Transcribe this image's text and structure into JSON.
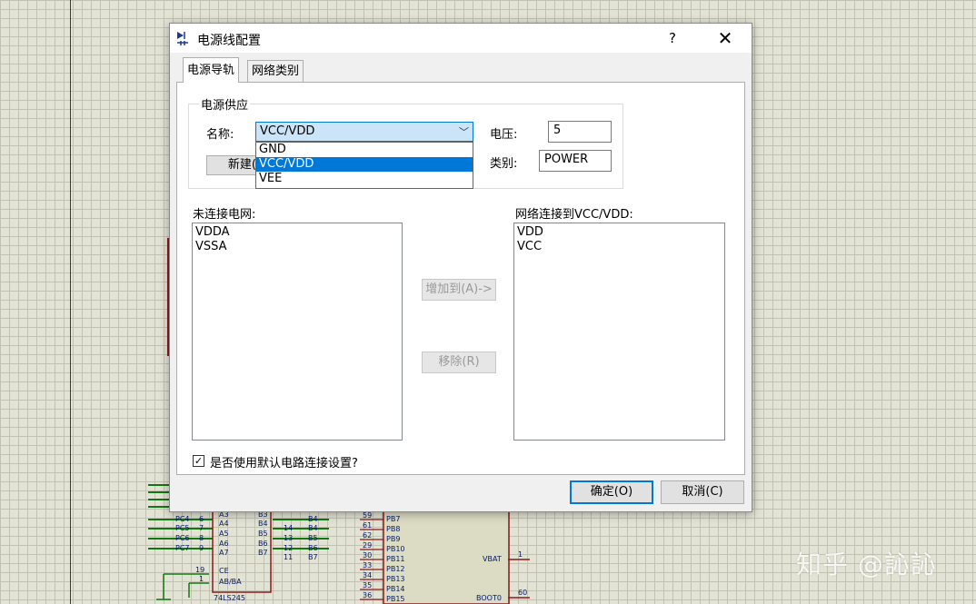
{
  "dialog": {
    "title": "电源线配置",
    "help_glyph": "?",
    "close_glyph": "✕",
    "tabs": [
      {
        "label": "电源导轨"
      },
      {
        "label": "网络类别"
      }
    ],
    "supply_group": {
      "label": "电源供应",
      "name_label": "名称:",
      "name_value": "VCC/VDD",
      "options": [
        "GND",
        "VCC/VDD",
        "VEE"
      ],
      "selected_option": "VCC/VDD",
      "new_button": "新建(",
      "voltage_label": "电压:",
      "voltage_value": "5",
      "class_label": "类别:",
      "class_value": "POWER"
    },
    "unconnected": {
      "label": "未连接电网:",
      "items": [
        "VDDA",
        "VSSA"
      ]
    },
    "connected": {
      "label": "网络连接到VCC/VDD:",
      "items": [
        "VDD",
        "VCC"
      ]
    },
    "add_button": "增加到(A)->",
    "remove_button": "移除(R)",
    "default_checkbox_label": "是否使用默认电路连接设置?",
    "default_checked": true,
    "ok_button": "确定(O)",
    "cancel_button": "取消(C)"
  },
  "schematic": {
    "left_pins": [
      {
        "net": "PC4",
        "pin": "6",
        "sig": "A3"
      },
      {
        "net": "PC5",
        "pin": "7",
        "sig": "A4"
      },
      {
        "net": "PC6",
        "pin": "8",
        "sig": "A5"
      },
      {
        "net": "PC7",
        "pin": "9",
        "sig": "A6"
      },
      {
        "net": "",
        "pin": "",
        "sig": "A7"
      }
    ],
    "right_pins": [
      {
        "sig": "B3",
        "pin": "",
        "net": "B4"
      },
      {
        "sig": "B4",
        "pin": "14",
        "net": "B4"
      },
      {
        "sig": "B5",
        "pin": "13",
        "net": "B5"
      },
      {
        "sig": "B6",
        "pin": "12",
        "net": "B6"
      },
      {
        "sig": "B7",
        "pin": "11",
        "net": "B7"
      }
    ],
    "ce_pin": {
      "num": "19",
      "label": "CE"
    },
    "ab_pin": {
      "num": "1",
      "label": "AB/BA"
    },
    "chip_name": "74LS245",
    "mcu_pins": [
      {
        "num": "59",
        "label": "PB7"
      },
      {
        "num": "61",
        "label": "PB8"
      },
      {
        "num": "62",
        "label": "PB9"
      },
      {
        "num": "29",
        "label": "PB10"
      },
      {
        "num": "30",
        "label": "PB11"
      },
      {
        "num": "33",
        "label": "PB12"
      },
      {
        "num": "34",
        "label": "PB13"
      },
      {
        "num": "35",
        "label": "PB14"
      },
      {
        "num": "36",
        "label": "PB15"
      }
    ],
    "vbat": {
      "label": "VBAT",
      "num": "1"
    },
    "boot0": {
      "label": "BOOT0",
      "num": "60"
    }
  },
  "watermark": "知乎 @訫訫"
}
